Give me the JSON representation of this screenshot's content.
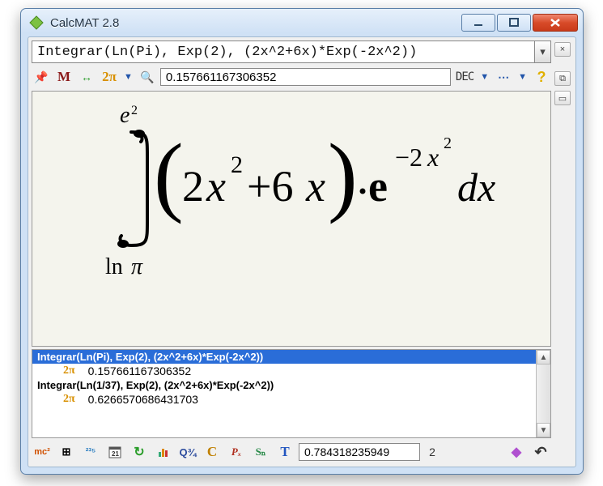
{
  "window": {
    "title": "CalcMAT 2.8"
  },
  "formula": {
    "input": "Integrar(Ln(Pi), Exp(2), (2x^2+6x)*Exp(-2x^2))"
  },
  "toolbar1": {
    "result": "0.157661167306352",
    "mode": "DEC"
  },
  "math": {
    "upper_bound": "e²",
    "lower_bound": "ln π",
    "integrand_poly": "2x²+6x",
    "exp_base": "e",
    "exp_sup": "-2x²",
    "dx": "dx"
  },
  "history": {
    "items": [
      {
        "expr": "Integrar(Ln(Pi), Exp(2), (2x^2+6x)*Exp(-2x^2))",
        "value": "0.157661167306352",
        "selected": true
      },
      {
        "expr": "Integrar(Ln(1/37), Exp(2), (2x^2+6x)*Exp(-2x^2))",
        "value": "0.6266570686431703",
        "selected": false
      }
    ]
  },
  "bottombar": {
    "value": "0.784318235949",
    "page": "2"
  },
  "icons": {
    "pin": "📌",
    "M": "M",
    "resize": "↔",
    "twopi": "2π",
    "magnify": "🔍",
    "ellipsis": "⋯",
    "help": "?",
    "side_close": "×",
    "side_copy": "⧉",
    "side_mini": "▭",
    "mc": "mc²",
    "grid": "⊞",
    "nums": "²³⁵",
    "cal": "📅",
    "redo": "↻",
    "stats": "📊",
    "Q": "Q¾",
    "C": "C",
    "Px": "Pₓ",
    "Sn": "Sₙ",
    "T": "T",
    "diamond": "◆",
    "undo": "↶"
  }
}
